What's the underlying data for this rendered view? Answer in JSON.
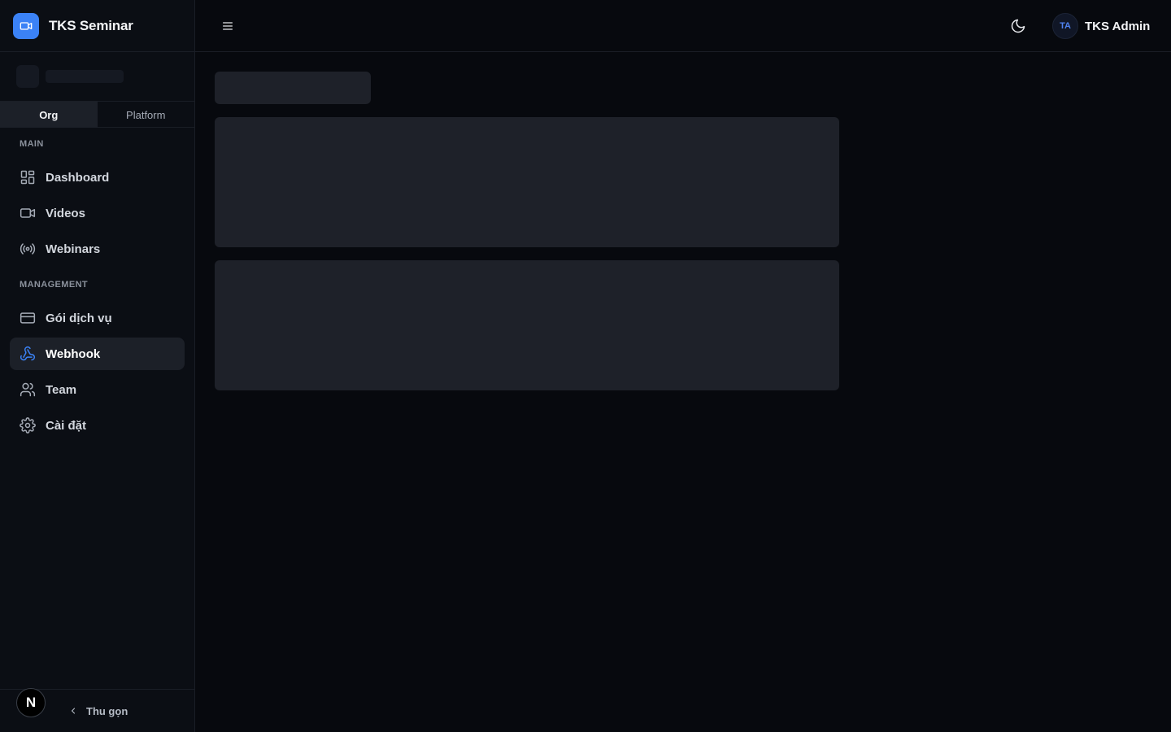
{
  "brand": {
    "name": "TKS Seminar",
    "logo_icon": "video-camera-icon",
    "accent": "#3b82f6"
  },
  "scope_tabs": [
    {
      "label": "Org",
      "active": true
    },
    {
      "label": "Platform",
      "active": false
    }
  ],
  "sections": {
    "main": "MAIN",
    "management": "MANAGEMENT"
  },
  "nav": {
    "main": [
      {
        "label": "Dashboard",
        "icon": "dashboard-grid-icon"
      },
      {
        "label": "Videos",
        "icon": "video-camera-icon"
      },
      {
        "label": "Webinars",
        "icon": "broadcast-icon"
      }
    ],
    "management": [
      {
        "label": "Gói dịch vụ",
        "icon": "credit-card-icon"
      },
      {
        "label": "Webhook",
        "icon": "webhook-icon",
        "active": true
      },
      {
        "label": "Team",
        "icon": "users-icon"
      },
      {
        "label": "Cài đặt",
        "icon": "gear-icon"
      }
    ]
  },
  "footer": {
    "badge": "N",
    "collapse_label": "Thu gọn"
  },
  "topbar": {
    "menu_icon": "hamburger-menu-icon",
    "theme_icon": "moon-icon",
    "user": {
      "initials": "TA",
      "name": "TKS Admin"
    }
  },
  "colors": {
    "background": "#07090e",
    "sidebar": "#0b0e14",
    "active_item": "#1c2028",
    "skeleton": "#1e2129",
    "active_icon": "#3b82f6"
  }
}
